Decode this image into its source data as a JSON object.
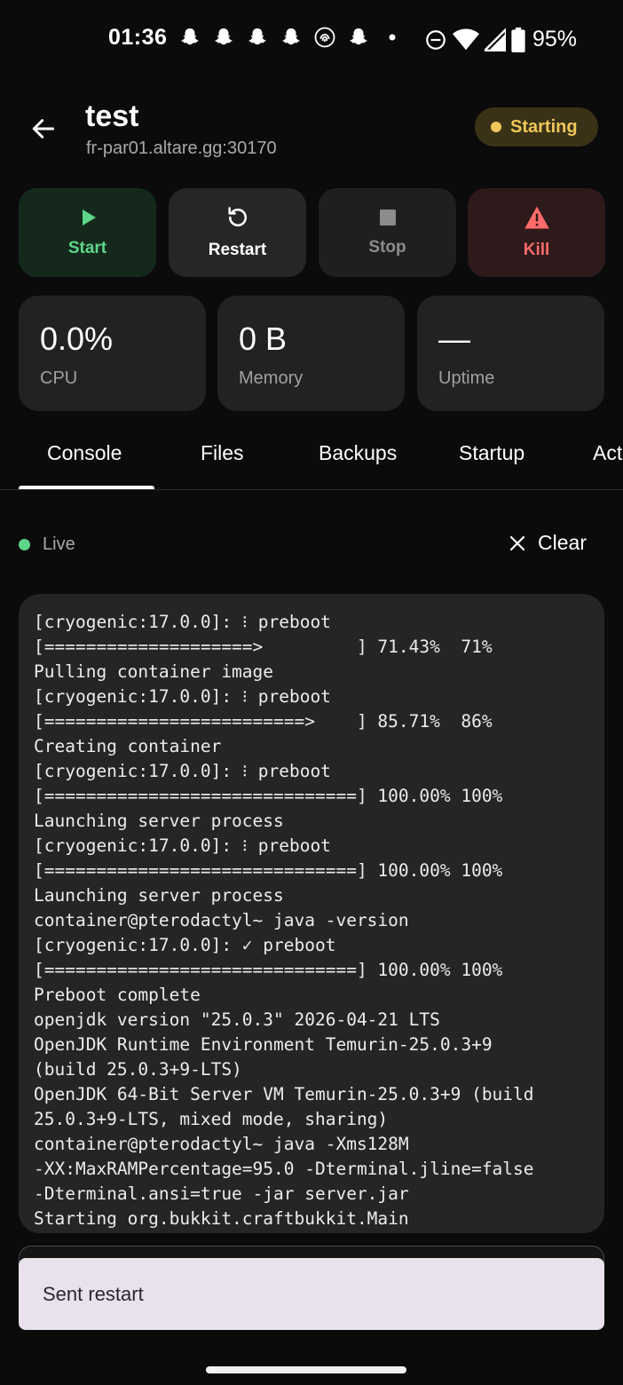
{
  "status_bar": {
    "time": "01:36",
    "battery": "95%",
    "notification_icons": [
      "snapchat-icon",
      "snapchat-icon",
      "snapchat-icon",
      "snapchat-icon",
      "fingerprint-icon",
      "snapchat-icon",
      "dot-icon"
    ],
    "system_icons": [
      "dnd-icon",
      "wifi-icon",
      "signal-icon",
      "battery-icon"
    ]
  },
  "header": {
    "title": "test",
    "address": "fr-par01.altare.gg:30170",
    "status": "Starting",
    "status_color": "#f0c75a"
  },
  "actions": {
    "start": "Start",
    "restart": "Restart",
    "stop": "Stop",
    "kill": "Kill"
  },
  "stats": {
    "cpu_value": "0.0%",
    "cpu_label": "CPU",
    "memory_value": "0 B",
    "memory_label": "Memory",
    "uptime_value": "—",
    "uptime_label": "Uptime"
  },
  "tabs": [
    "Console",
    "Files",
    "Backups",
    "Startup",
    "Act"
  ],
  "console": {
    "live_label": "Live",
    "clear_label": "Clear",
    "lines": [
      "[cryogenic:17.0.0]: ⁝ preboot",
      "[====================>         ] 71.43%  71%",
      "Pulling container image",
      "[cryogenic:17.0.0]: ⁝ preboot",
      "[=========================>    ] 85.71%  86%",
      "Creating container",
      "[cryogenic:17.0.0]: ⁝ preboot",
      "[==============================] 100.00% 100%",
      "Launching server process",
      "[cryogenic:17.0.0]: ⁝ preboot",
      "[==============================] 100.00% 100%",
      "Launching server process",
      "container@pterodactyl~ java -version",
      "[cryogenic:17.0.0]: ✓ preboot",
      "[==============================] 100.00% 100%",
      "Preboot complete",
      "openjdk version \"25.0.3\" 2026-04-21 LTS",
      "OpenJDK Runtime Environment Temurin-25.0.3+9",
      "(build 25.0.3+9-LTS)",
      "OpenJDK 64-Bit Server VM Temurin-25.0.3+9 (build",
      "25.0.3+9-LTS, mixed mode, sharing)",
      "container@pterodactyl~ java -Xms128M",
      "-XX:MaxRAMPercentage=95.0 -Dterminal.jline=false",
      "-Dterminal.ansi=true -jar server.jar",
      "Starting org.bukkit.craftbukkit.Main"
    ]
  },
  "snackbar": {
    "message": "Sent restart"
  }
}
